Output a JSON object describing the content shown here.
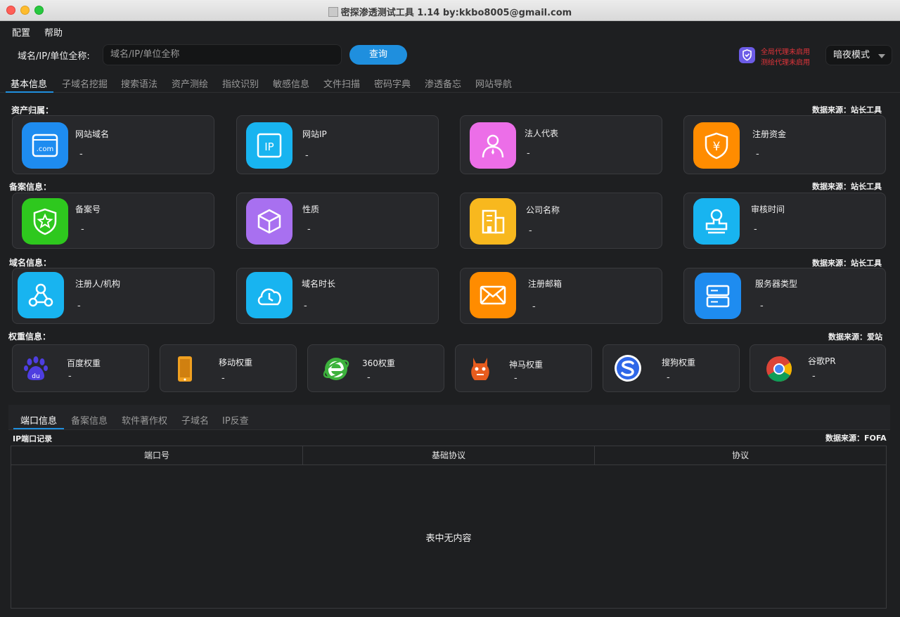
{
  "window": {
    "title": "密探渗透测试工具 1.14 by:kkbo8005@gmail.com"
  },
  "menu": {
    "items": [
      "配置",
      "帮助"
    ]
  },
  "search": {
    "label": "域名/IP/单位全称:",
    "placeholder": "域名/IP/单位全称",
    "button": "查询"
  },
  "proxy": {
    "global": "全局代理未启用",
    "test": "测绘代理未启用"
  },
  "theme": {
    "selected": "暗夜模式"
  },
  "main_tabs": [
    "基本信息",
    "子域名挖掘",
    "搜索语法",
    "资产测绘",
    "指纹识别",
    "敏感信息",
    "文件扫描",
    "密码字典",
    "渗透备忘",
    "网站导航"
  ],
  "sections": {
    "asset": {
      "label": "资产归属：",
      "source": "数据来源：站长工具",
      "cards": [
        {
          "title": "网站域名",
          "value": "-",
          "icon": "domain-icon",
          "color": "#1e8cf0"
        },
        {
          "title": "网站IP",
          "value": "-",
          "icon": "ip-icon",
          "color": "#18b4f0"
        },
        {
          "title": "法人代表",
          "value": "-",
          "icon": "person-icon",
          "color": "#ec6ee8"
        },
        {
          "title": "注册资金",
          "value": "-",
          "icon": "yen-shield-icon",
          "color": "#ff8c00"
        }
      ]
    },
    "icp": {
      "label": "备案信息：",
      "source": "数据来源：站长工具",
      "cards": [
        {
          "title": "备案号",
          "value": "-",
          "icon": "star-shield-icon",
          "color": "#2ec81e"
        },
        {
          "title": "性质",
          "value": "-",
          "icon": "cube-icon",
          "color": "#a870f0"
        },
        {
          "title": "公司名称",
          "value": "-",
          "icon": "building-icon",
          "color": "#f8b81e"
        },
        {
          "title": "审核时间",
          "value": "-",
          "icon": "stamp-icon",
          "color": "#18b4f0"
        }
      ]
    },
    "domain": {
      "label": "域名信息：",
      "source": "数据来源：站长工具",
      "cards": [
        {
          "title": "注册人/机构",
          "value": "-",
          "icon": "network-icon",
          "color": "#18b4f0"
        },
        {
          "title": "域名时长",
          "value": "-",
          "icon": "clock-cloud-icon",
          "color": "#18b4f0"
        },
        {
          "title": "注册邮箱",
          "value": "-",
          "icon": "mail-icon",
          "color": "#ff8c00"
        },
        {
          "title": "服务器类型",
          "value": "-",
          "icon": "server-icon",
          "color": "#1e8cf0"
        }
      ]
    },
    "weight": {
      "label": "权重信息：",
      "source": "数据来源：爱站",
      "cards": [
        {
          "title": "百度权重",
          "value": "-",
          "icon": "baidu-paw-icon"
        },
        {
          "title": "移动权重",
          "value": "-",
          "icon": "mobile-icon"
        },
        {
          "title": "360权重",
          "value": "-",
          "icon": "ie-icon"
        },
        {
          "title": "神马权重",
          "value": "-",
          "icon": "shenma-icon"
        },
        {
          "title": "搜狗权重",
          "value": "-",
          "icon": "sogou-icon"
        },
        {
          "title": "谷歌PR",
          "value": "-",
          "icon": "chrome-icon"
        }
      ]
    }
  },
  "lower": {
    "tabs": [
      "端口信息",
      "备案信息",
      "软件著作权",
      "子域名",
      "IP反查"
    ],
    "record_label": "IP端口记录",
    "source": "数据来源：FOFA",
    "columns": [
      "端口号",
      "基础协议",
      "协议"
    ],
    "empty": "表中无内容"
  }
}
